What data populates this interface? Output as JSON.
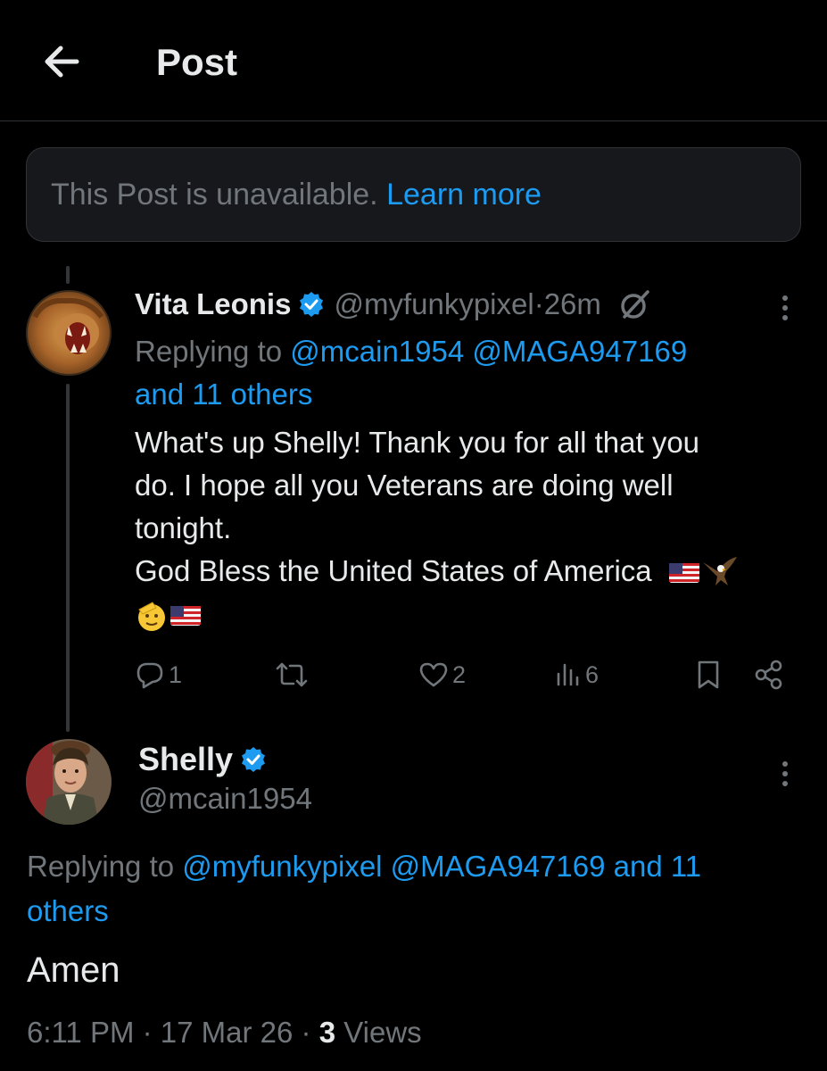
{
  "header": {
    "title": "Post"
  },
  "unavailable": {
    "text": "This Post is unavailable.",
    "link": "Learn more"
  },
  "post1": {
    "name": "Vita Leonis",
    "handle": "@myfunkypixel",
    "sep": " · ",
    "time": "26m",
    "replying_prefix": "Replying to ",
    "replying_handles": "@mcain1954 @MAGA947169",
    "replying_others": "and 11 others",
    "body_lines": [
      "What's up Shelly! Thank you for all that you",
      "do. I hope all you Veterans are doing well",
      "tonight.",
      "God Bless the United States of America"
    ],
    "emojis": [
      "us-flag",
      "eagle",
      "saluting-face",
      "us-flag"
    ],
    "stats": {
      "replies": "1",
      "likes": "2",
      "views": "6"
    }
  },
  "post2": {
    "name": "Shelly",
    "handle": "@mcain1954",
    "replying_prefix": "Replying to ",
    "replying_handles": "@myfunkypixel @MAGA947169 and 11",
    "replying_others": "others",
    "text": "Amen",
    "time": "6:11 PM",
    "dot": " · ",
    "date": "17 Mar 26",
    "views_count": "3",
    "views_label": " Views"
  },
  "colors": {
    "accent": "#1d9bf0",
    "muted": "#71767b",
    "text": "#e7e9ea",
    "bg": "#000000"
  }
}
